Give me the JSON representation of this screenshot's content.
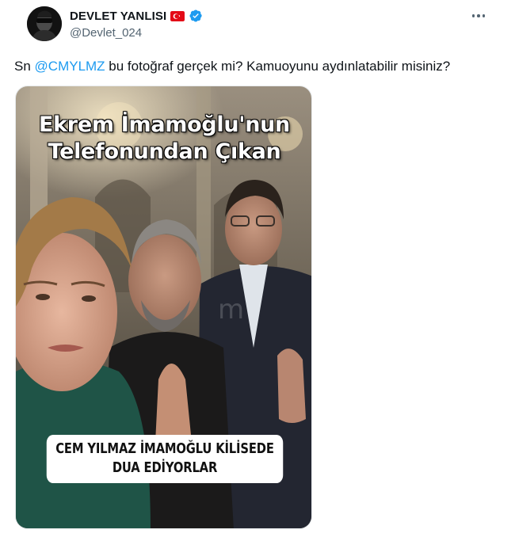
{
  "author": {
    "display_name": "DEVLET YANLISI",
    "handle": "@Devlet_024",
    "verified": true,
    "flag": "turkey-flag-icon",
    "avatar": "profile-photo"
  },
  "tweet": {
    "text_prefix": "Sn ",
    "mention": "@CMYLMZ",
    "text_suffix": " bu fotoğraf gerçek mi? Kamuoyunu aydınlatabilir misiniz?"
  },
  "media": {
    "headline_line1": "Ekrem İmamoğlu'nun",
    "headline_line2": "Telefonundan Çıkan",
    "caption_line1": "CEM YILMAZ İMAMOĞLU KİLİSEDE",
    "caption_line2": "DUA EDİYORLAR",
    "watermark": "m"
  },
  "colors": {
    "mention": "#1d9bf0",
    "secondary_text": "#536471",
    "verified_badge": "#1d9bf0",
    "flag_red": "#e30a17"
  },
  "icons": {
    "more": "more-horizontal-icon",
    "verified": "verified-badge-icon"
  }
}
